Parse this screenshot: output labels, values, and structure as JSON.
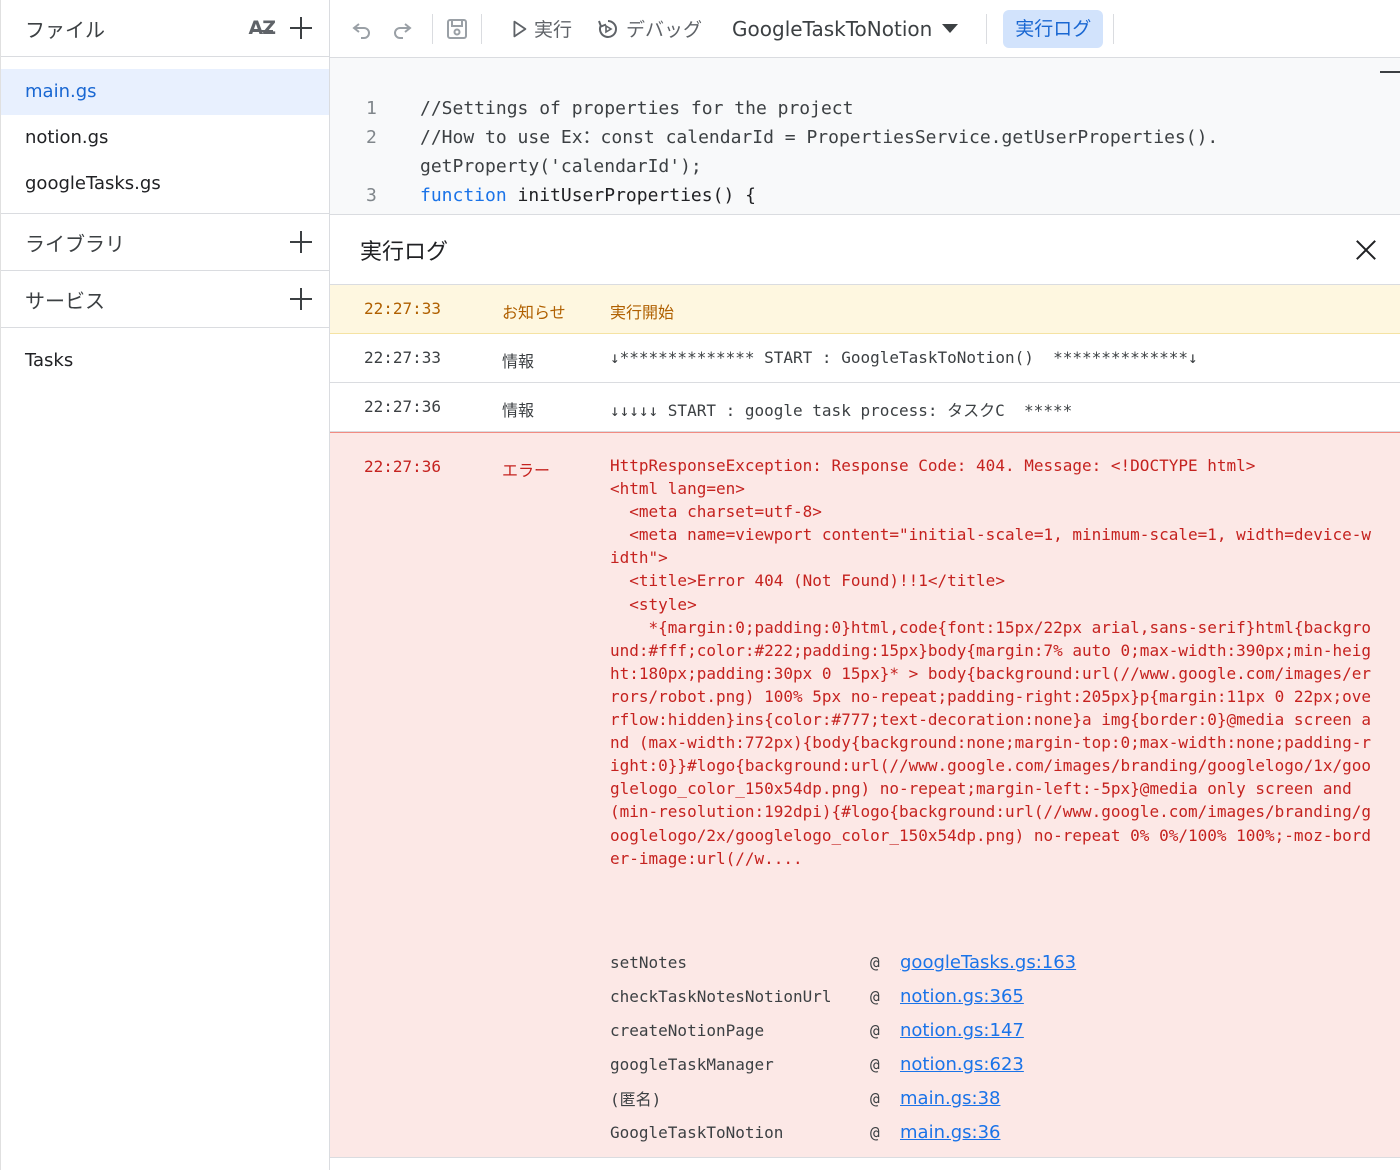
{
  "sidebar": {
    "files_title": "ファイル",
    "sort_icon_text": "AZ",
    "files": [
      "main.gs",
      "notion.gs",
      "googleTasks.gs"
    ],
    "active_file": 0,
    "library_title": "ライブラリ",
    "services_title": "サービス",
    "services": [
      "Tasks"
    ]
  },
  "toolbar": {
    "run_label": "実行",
    "debug_label": "デバッグ",
    "function_name": "GoogleTaskToNotion",
    "log_label": "実行ログ"
  },
  "editor": {
    "lines": [
      {
        "num": "1",
        "text": "//Settings of properties for the project"
      },
      {
        "num": "2",
        "text": "//How to use Ex：const calendarId = PropertiesService.getUserProperties()."
      },
      {
        "num": "",
        "text": "getProperty('calendarId');"
      },
      {
        "num": "3",
        "keyword": "function",
        "text": " initUserProperties() {"
      }
    ]
  },
  "log": {
    "title": "実行ログ",
    "rows": [
      {
        "time": "22:27:33",
        "level": "お知らせ",
        "message": "実行開始"
      },
      {
        "time": "22:27:33",
        "level": "情報",
        "message": "↓************** START : GoogleTaskToNotion()  **************↓"
      },
      {
        "time": "22:27:36",
        "level": "情報",
        "message": "↓↓↓↓↓ START : google task process: タスクC  *****"
      }
    ],
    "error": {
      "time": "22:27:36",
      "level": "エラー",
      "message": "HttpResponseException: Response Code: 404. Message: <!DOCTYPE html>\n<html lang=en>\n  <meta charset=utf-8>\n  <meta name=viewport content=\"initial-scale=1, minimum-scale=1, width=device-width\">\n  <title>Error 404 (Not Found)!!1</title>\n  <style>\n    *{margin:0;padding:0}html,code{font:15px/22px arial,sans-serif}html{background:#fff;color:#222;padding:15px}body{margin:7% auto 0;max-width:390px;min-height:180px;padding:30px 0 15px}* > body{background:url(//www.google.com/images/errors/robot.png) 100% 5px no-repeat;padding-right:205px}p{margin:11px 0 22px;overflow:hidden}ins{color:#777;text-decoration:none}a img{border:0}@media screen and (max-width:772px){body{background:none;margin-top:0;max-width:none;padding-right:0}}#logo{background:url(//www.google.com/images/branding/googlelogo/1x/googlelogo_color_150x54dp.png) no-repeat;margin-left:-5px}@media only screen and (min-resolution:192dpi){#logo{background:url(//www.google.com/images/branding/googlelogo/2x/googlelogo_color_150x54dp.png) no-repeat 0% 0%/100% 100%;-moz-border-image:url(//w....",
      "stack": [
        {
          "fn": "setNotes",
          "at": "@",
          "loc": "googleTasks.gs:163"
        },
        {
          "fn": "checkTaskNotesNotionUrl",
          "at": "@",
          "loc": "notion.gs:365"
        },
        {
          "fn": "createNotionPage",
          "at": "@",
          "loc": "notion.gs:147"
        },
        {
          "fn": "googleTaskManager",
          "at": "@",
          "loc": "notion.gs:623"
        },
        {
          "fn": "(匿名)",
          "at": "@",
          "loc": "main.gs:38"
        },
        {
          "fn": "GoogleTaskToNotion",
          "at": "@",
          "loc": "main.gs:36"
        }
      ]
    }
  }
}
